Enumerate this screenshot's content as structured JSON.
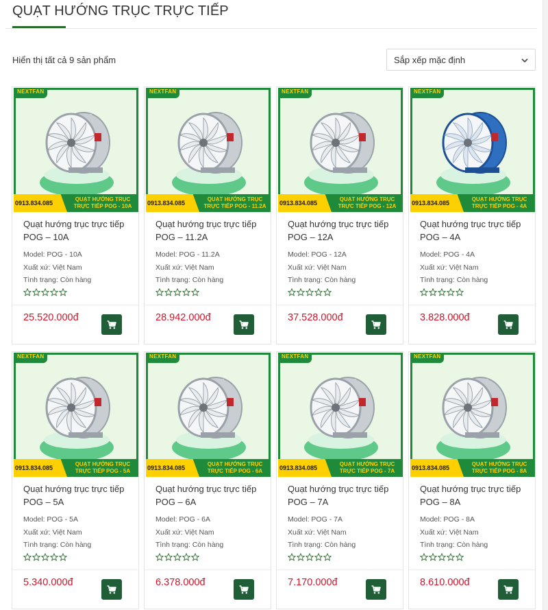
{
  "page": {
    "title": "QUẠT HƯỚNG TRỤC TRỰC TIẾP",
    "result_count": "Hiển thị tất cả 9 sản phẩm",
    "sort": {
      "selected": "Sắp xếp mặc định"
    }
  },
  "colors": {
    "brand_green": "#1f8a3a",
    "price_red": "#d0142a",
    "cart_green": "#1f5e36",
    "banner_yellow": "#ffd000"
  },
  "products": [
    {
      "name": "Quạt hướng trục trực tiếp POG – 10A",
      "brand": "NEXTFAN",
      "phone": "0913.834.085",
      "banner_line1": "QUẠT HƯỚNG TRỤC",
      "banner_line2": "TRỰC TIẾP POG - 10A",
      "model": "Model: POG - 10A",
      "origin": "Xuất xứ: Việt Nam",
      "status": "Tình trạng: Còn hàng",
      "price": "25.520.000đ",
      "rating": 0,
      "fan_color": "silver"
    },
    {
      "name": "Quạt hướng trục trực tiếp POG – 11.2A",
      "brand": "NEXTFAN",
      "phone": "0913.834.085",
      "banner_line1": "QUẠT HƯỚNG TRỤC",
      "banner_line2": "TRỰC TIẾP POG - 11.2A",
      "model": "Model: POG - 11.2A",
      "origin": "Xuất xứ: Việt Nam",
      "status": "Tình trạng: Còn hàng",
      "price": "28.942.000đ",
      "rating": 0,
      "fan_color": "silver"
    },
    {
      "name": "Quạt hướng trục trực tiếp POG – 12A",
      "brand": "NEXTFAN",
      "phone": "0913.834.085",
      "banner_line1": "QUẠT HƯỚNG TRỤC",
      "banner_line2": "TRỰC TIẾP POG - 12A",
      "model": "Model: POG - 12A",
      "origin": "Xuất xứ: Việt Nam",
      "status": "Tình trạng: Còn hàng",
      "price": "37.528.000đ",
      "rating": 0,
      "fan_color": "silver"
    },
    {
      "name": "Quạt hướng trục trực tiếp POG – 4A",
      "brand": "NEXTFAN",
      "phone": "0913.834.085",
      "banner_line1": "QUẠT HƯỚNG TRỤC",
      "banner_line2": "TRỰC TIẾP POG - 4A",
      "model": "Model: POG - 4A",
      "origin": "Xuất xứ: Việt Nam",
      "status": "Tình trạng: Còn hàng",
      "price": "3.828.000đ",
      "rating": 0,
      "fan_color": "blue"
    },
    {
      "name": "Quạt hướng trục trực tiếp POG – 5A",
      "brand": "NEXTFAN",
      "phone": "0913.834.085",
      "banner_line1": "QUẠT HƯỚNG TRỤC",
      "banner_line2": "TRỰC TIẾP POG - 5A",
      "model": "Model: POG - 5A",
      "origin": "Xuất xứ: Việt Nam",
      "status": "Tình trạng: Còn hàng",
      "price": "5.340.000đ",
      "rating": 0,
      "fan_color": "silver"
    },
    {
      "name": "Quạt hướng trục trực tiếp POG – 6A",
      "brand": "NEXTFAN",
      "phone": "0913.834.085",
      "banner_line1": "QUẠT HƯỚNG TRỤC",
      "banner_line2": "TRỰC TIẾP POG - 6A",
      "model": "Model: POG - 6A",
      "origin": "Xuất xứ: Việt Nam",
      "status": "Tình trạng: Còn hàng",
      "price": "6.378.000đ",
      "rating": 0,
      "fan_color": "silver"
    },
    {
      "name": "Quạt hướng trục trực tiếp POG – 7A",
      "brand": "NEXTFAN",
      "phone": "0913.834.085",
      "banner_line1": "QUẠT HƯỚNG TRỤC",
      "banner_line2": "TRỰC TIẾP POG - 7A",
      "model": "Model: POG - 7A",
      "origin": "Xuất xứ: Việt Nam",
      "status": "Tình trạng: Còn hàng",
      "price": "7.170.000đ",
      "rating": 0,
      "fan_color": "silver"
    },
    {
      "name": "Quạt hướng trục trực tiếp POG – 8A",
      "brand": "NEXTFAN",
      "phone": "0913.834.085",
      "banner_line1": "QUẠT HƯỚNG TRỤC",
      "banner_line2": "TRỰC TIẾP POG - 8A",
      "model": "Model: POG - 8A",
      "origin": "Xuất xứ: Việt Nam",
      "status": "Tình trạng: Còn hàng",
      "price": "8.610.000đ",
      "rating": 0,
      "fan_color": "silver"
    }
  ],
  "icons": {
    "sort": "chevron-down-icon",
    "cart": "cart-icon",
    "star": "star-outline-icon"
  }
}
